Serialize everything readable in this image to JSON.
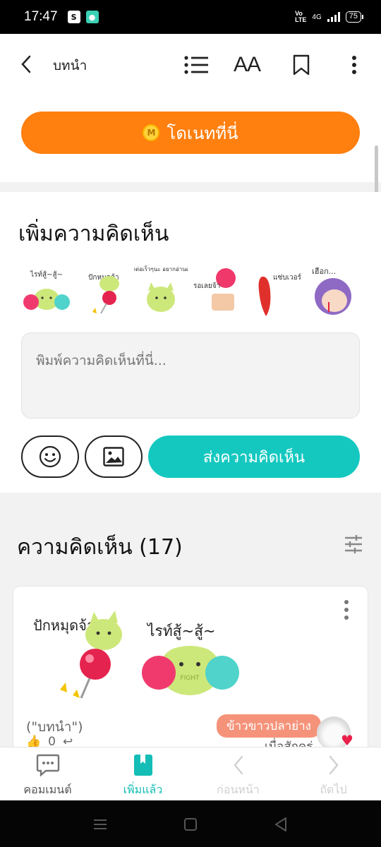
{
  "status_bar": {
    "time": "17:47",
    "network": "4G",
    "volte": "Vo\nLTE",
    "battery": "75"
  },
  "appbar": {
    "title": "บทนำ",
    "icons": [
      "back-icon",
      "list-icon",
      "font-size-icon",
      "bookmark-icon",
      "more-icon"
    ],
    "font_label": "AA"
  },
  "donate": {
    "label": "โดเนทที่นี่",
    "coin": "M"
  },
  "add_comment": {
    "title": "เพิ่มความคิดเห็น",
    "stickers": [
      {
        "name": "cheer-cat",
        "caption": "ไรท์สู้~สู้~"
      },
      {
        "name": "pin-cat",
        "caption": "ปักหมุดจ้า"
      },
      {
        "name": "waiting-cat",
        "caption": "มาต่อเร็วๆนะ อยากอ่านต่อ"
      },
      {
        "name": "waiting-girl",
        "caption": "รอเลยจ้า"
      },
      {
        "name": "chili",
        "caption": "แซ่บเวอร์"
      },
      {
        "name": "nosebleed-girl",
        "caption": "เฮือก..."
      }
    ],
    "input_placeholder": "พิมพ์ความคิดเห็นที่นี่...",
    "send_label": "ส่งความคิดเห็น"
  },
  "comments": {
    "title": "ความคิดเห็น (17)",
    "items": [
      {
        "stickers": [
          {
            "caption": "ปักหมุดจ้า"
          },
          {
            "caption": "ไรท์สู้~สู้~",
            "sub": "FIGHT"
          }
        ],
        "ref": "(\"บทนำ\")",
        "badge": "ข้าวขาวปลาย่าง",
        "time": "เมื่อสักครู่",
        "likes": "0"
      }
    ]
  },
  "bottom_nav": [
    {
      "label": "คอมเมนต์",
      "state": "normal"
    },
    {
      "label": "เพิ่มแล้ว",
      "state": "active"
    },
    {
      "label": "ก่อนหน้า",
      "state": "disabled"
    },
    {
      "label": "ถัดไป",
      "state": "disabled"
    }
  ],
  "colors": {
    "accent_orange": "#ff7f0f",
    "teal": "#14c8c0",
    "badge": "#f5937a",
    "heart": "#e8204a"
  }
}
